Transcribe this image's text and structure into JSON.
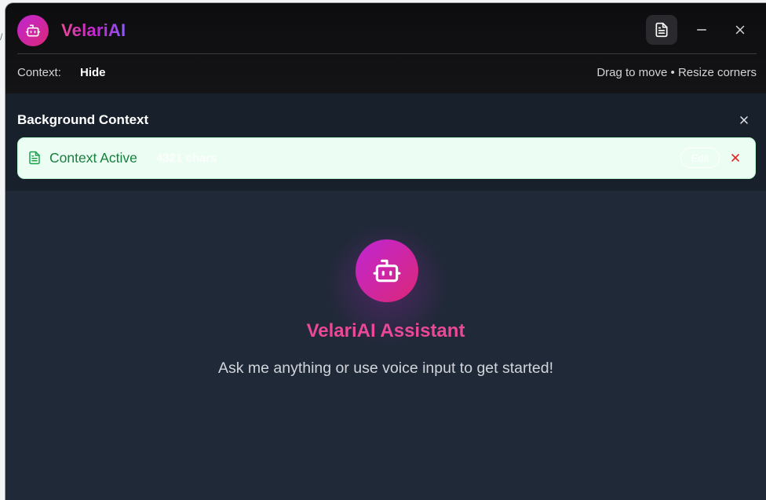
{
  "backdrop": {
    "stray_char": "/"
  },
  "window": {
    "app_name": "VelariAI",
    "logo_icon": "robot-icon",
    "actions": {
      "document_icon": "document-icon",
      "minimize_icon": "minimize-icon",
      "close_icon": "close-icon"
    }
  },
  "toolbar": {
    "context_label": "Context:",
    "hide_label": "Hide",
    "drag_hint": "Drag to move • Resize corners"
  },
  "context_panel": {
    "title": "Background Context",
    "close_icon": "close-icon",
    "card": {
      "status": "Context Active",
      "char_count": "4321 chars",
      "edit_label": "Edit",
      "remove_icon": "close-icon",
      "doc_icon": "document-icon"
    }
  },
  "welcome": {
    "title": "VelariAI Assistant",
    "subtitle": "Ask me anything or use voice input to get started!",
    "avatar_icon": "robot-icon"
  },
  "colors": {
    "accent_magenta": "#c026d3",
    "accent_pink": "#ec4899",
    "success_green": "#15803d",
    "success_bg": "#ecfdf3",
    "danger_red": "#dc2626",
    "window_bg": "#1f2937",
    "titlebar_bg": "#0d0d0f"
  }
}
